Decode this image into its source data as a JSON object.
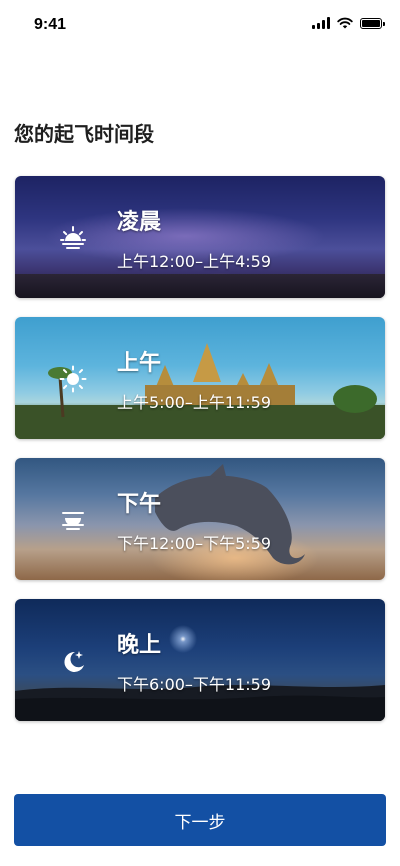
{
  "status_bar": {
    "time": "9:41"
  },
  "heading": "您的起飞时间段",
  "slots": [
    {
      "label": "凌晨",
      "range": "上午12:00–上午4:59",
      "icon": "sunrise-icon"
    },
    {
      "label": "上午",
      "range": "上午5:00–上午11:59",
      "icon": "sun-icon"
    },
    {
      "label": "下午",
      "range": "下午12:00–下午5:59",
      "icon": "sunset-icon"
    },
    {
      "label": "晚上",
      "range": "下午6:00–下午11:59",
      "icon": "moon-icon"
    }
  ],
  "next_button": "下一步",
  "colors": {
    "primary": "#1350a4"
  }
}
